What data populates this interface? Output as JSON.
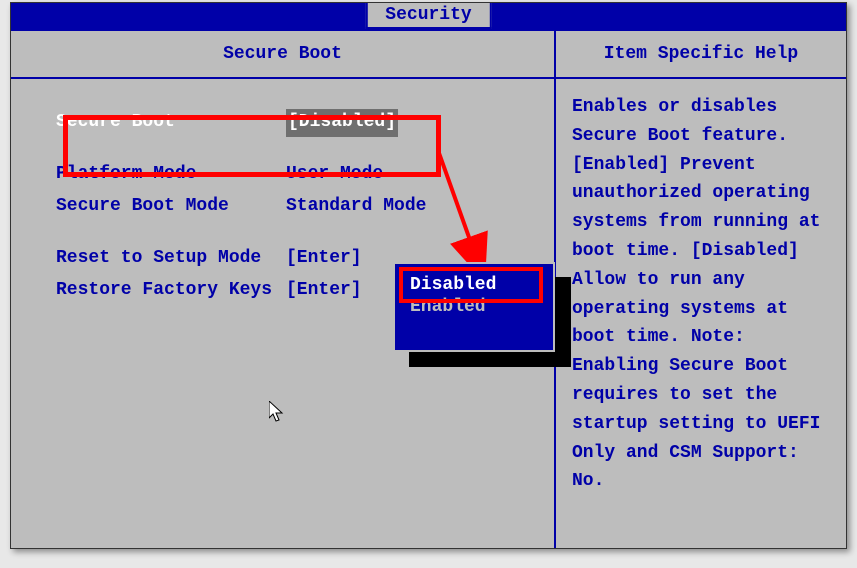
{
  "tab_label": "Security",
  "left_header": "Secure Boot",
  "right_header": "Item Specific Help",
  "settings": {
    "secure_boot": {
      "label": "Secure Boot",
      "value": "[Disabled]"
    },
    "platform_mode": {
      "label": "Platform Mode",
      "value": "User Mode"
    },
    "secure_boot_mode": {
      "label": "Secure Boot Mode",
      "value": "Standard Mode"
    },
    "reset_setup": {
      "label": "Reset to Setup Mode",
      "value": "[Enter]"
    },
    "restore_keys": {
      "label": "Restore Factory Keys",
      "value": "[Enter]"
    }
  },
  "popup": {
    "option_disabled": "Disabled",
    "option_enabled": "Enabled"
  },
  "help_text": "Enables or disables Secure Boot feature. [Enabled] Prevent unauthorized operating systems from running at boot time. [Disabled] Allow to run any operating systems at boot time. Note: Enabling Secure Boot requires to set the startup setting to UEFI Only and CSM Support: No."
}
